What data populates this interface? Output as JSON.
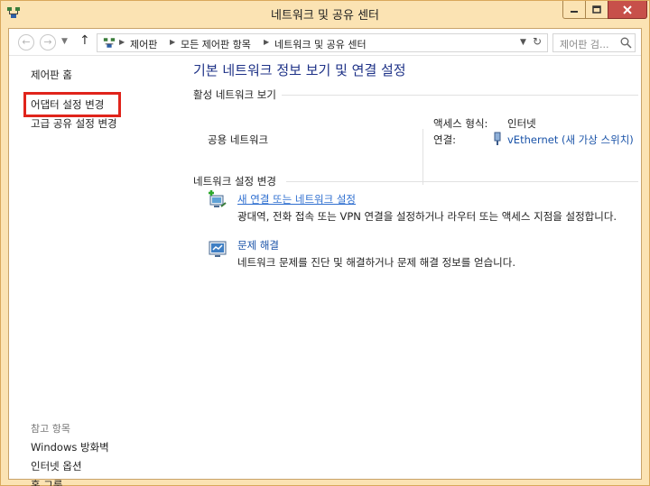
{
  "window": {
    "title": "네트워크 및 공유 센터"
  },
  "address": {
    "crumbs": [
      "제어판",
      "모든 제어판 항목",
      "네트워크 및 공유 센터"
    ],
    "search_placeholder": "제어판 검..."
  },
  "left_pane": {
    "links": [
      "제어판 홈",
      "어댑터 설정 변경",
      "고급 공유 설정 변경"
    ],
    "see_also_title": "참고 항목",
    "see_also": [
      "Windows 방화벽",
      "인터넷 옵션",
      "홈 그룹"
    ]
  },
  "main": {
    "title": "기본 네트워크 정보 보기 및 연결 설정",
    "active_header": "활성 네트워크 보기",
    "network_name": "공용 네트워크",
    "access_type_label": "액세스 형식:",
    "access_type_value": "인터넷",
    "connection_label": "연결:",
    "connection_value": "vEthernet (새 가상 스위치)",
    "change_header": "네트워크 설정 변경",
    "tasks": [
      {
        "title": "새 연결 또는 네트워크 설정",
        "desc": "광대역, 전화 접속 또는 VPN 연결을 설정하거나 라우터 또는 액세스 지점을 설정합니다."
      },
      {
        "title": "문제 해결",
        "desc": "네트워크 문제를 진단 및 해결하거나 문제 해결 정보를 얻습니다."
      }
    ]
  },
  "colors": {
    "accent": "#1e3287",
    "link": "#1a53a8",
    "highlight": "#e0241b",
    "frame": "#fbe3b3",
    "close": "#c7504a"
  },
  "icons": [
    "network-icon",
    "minimize-icon",
    "maximize-icon",
    "close-icon",
    "search-icon",
    "refresh-icon",
    "new-connection-icon",
    "troubleshoot-icon",
    "usb-adapter-icon"
  ]
}
